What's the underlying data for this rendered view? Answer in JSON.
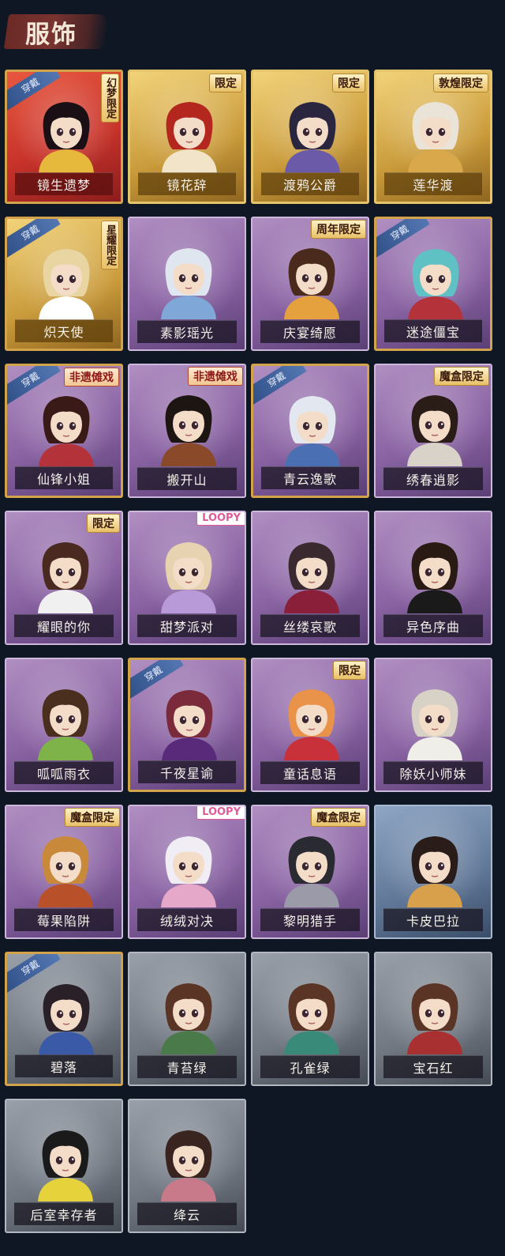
{
  "header": {
    "title": "服饰"
  },
  "badges": {
    "equipped": "穿戴"
  },
  "costumes": [
    {
      "name": "镜生遗梦",
      "frame": "red",
      "equipped": true,
      "tag": "幻梦限定",
      "vertical": true,
      "hair": "#1a0f14",
      "accent": "#e6b83b"
    },
    {
      "name": "镜花辞",
      "frame": "gold",
      "equipped": false,
      "tag": "限定",
      "hair": "#b4271f",
      "accent": "#f1e4c8"
    },
    {
      "name": "渡鸦公爵",
      "frame": "gold",
      "equipped": false,
      "tag": "限定",
      "hair": "#2a2640",
      "accent": "#6b5aa8"
    },
    {
      "name": "莲华渡",
      "frame": "gold",
      "equipped": false,
      "tag": "敦煌限定",
      "hair": "#e9e3d8",
      "accent": "#d8a84a"
    },
    {
      "name": "炽天使",
      "frame": "gold",
      "equipped": true,
      "tag": "星耀限定",
      "vertical": true,
      "hair": "#e8d5a2",
      "accent": "#ffffff"
    },
    {
      "name": "素影瑶光",
      "frame": "purple",
      "equipped": false,
      "tag": "",
      "hair": "#dfe6ef",
      "accent": "#7fa7d8"
    },
    {
      "name": "庆宴绮愿",
      "frame": "purple",
      "equipped": false,
      "tag": "周年限定",
      "hair": "#4a2a1c",
      "accent": "#e6a13f"
    },
    {
      "name": "迷途僵宝",
      "frame": "purple",
      "equipped": true,
      "tag": "",
      "hair": "#5fc1c4",
      "accent": "#b4333a"
    },
    {
      "name": "仙锋小姐",
      "frame": "purple",
      "equipped": true,
      "tag": "非遗傩戏",
      "redInk": true,
      "hair": "#3a1a16",
      "accent": "#b4333a"
    },
    {
      "name": "搬开山",
      "frame": "purple",
      "equipped": false,
      "tag": "非遗傩戏",
      "redInk": true,
      "hair": "#1c1512",
      "accent": "#8a4a2a"
    },
    {
      "name": "青云逸歌",
      "frame": "purple",
      "equipped": true,
      "tag": "",
      "hair": "#e3e8f0",
      "accent": "#4a6fb3"
    },
    {
      "name": "绣春逍影",
      "frame": "purple",
      "equipped": false,
      "tag": "魔盒限定",
      "hair": "#2a1c16",
      "accent": "#d8d2c8"
    },
    {
      "name": "耀眼的你",
      "frame": "purple",
      "equipped": false,
      "tag": "限定",
      "hair": "#4a2a20",
      "accent": "#f0f0f0"
    },
    {
      "name": "甜梦派对",
      "frame": "purple",
      "equipped": false,
      "tag": "LOOPY",
      "loopy": true,
      "hair": "#e8d3b0",
      "accent": "#b89ad8"
    },
    {
      "name": "丝缕哀歌",
      "frame": "purple",
      "equipped": false,
      "tag": "",
      "hair": "#3a2a30",
      "accent": "#8a1f3a"
    },
    {
      "name": "异色序曲",
      "frame": "purple",
      "equipped": false,
      "tag": "",
      "hair": "#2a1a14",
      "accent": "#1a1a1a"
    },
    {
      "name": "呱呱雨衣",
      "frame": "purple",
      "equipped": false,
      "tag": "",
      "hair": "#4a2e1e",
      "accent": "#7eb34a"
    },
    {
      "name": "千夜星谕",
      "frame": "purple",
      "equipped": true,
      "tag": "",
      "hair": "#7a2a3a",
      "accent": "#5a2a7a"
    },
    {
      "name": "童话息语",
      "frame": "purple",
      "equipped": false,
      "tag": "限定",
      "hair": "#e8924a",
      "accent": "#c8303a"
    },
    {
      "name": "除妖小师妹",
      "frame": "purple",
      "equipped": false,
      "tag": "",
      "hair": "#d8d2c6",
      "accent": "#f0eee8"
    },
    {
      "name": "莓果陷阱",
      "frame": "purple",
      "equipped": false,
      "tag": "魔盒限定",
      "hair": "#c8893a",
      "accent": "#b8502a"
    },
    {
      "name": "绒绒对决",
      "frame": "purple",
      "equipped": false,
      "tag": "LOOPY",
      "loopy": true,
      "hair": "#f0eef4",
      "accent": "#e6a8c8"
    },
    {
      "name": "黎明猎手",
      "frame": "purple",
      "equipped": false,
      "tag": "魔盒限定",
      "hair": "#2a2a32",
      "accent": "#9a9aa8"
    },
    {
      "name": "卡皮巴拉",
      "frame": "blue",
      "equipped": false,
      "tag": "",
      "hair": "#2a1c18",
      "accent": "#d8a04a"
    },
    {
      "name": "碧落",
      "frame": "grey",
      "equipped": true,
      "tag": "",
      "hair": "#2a2028",
      "accent": "#3a5aa8"
    },
    {
      "name": "青苔绿",
      "frame": "grey",
      "equipped": false,
      "tag": "",
      "hair": "#5a3424",
      "accent": "#4a7a4a"
    },
    {
      "name": "孔雀绿",
      "frame": "grey",
      "equipped": false,
      "tag": "",
      "hair": "#5a3424",
      "accent": "#3a8a7a"
    },
    {
      "name": "宝石红",
      "frame": "grey",
      "equipped": false,
      "tag": "",
      "hair": "#5a3424",
      "accent": "#a83030"
    },
    {
      "name": "后室幸存者",
      "frame": "grey",
      "equipped": false,
      "tag": "",
      "hair": "#1a1a1a",
      "accent": "#e6d23a"
    },
    {
      "name": "绛云",
      "frame": "grey",
      "equipped": false,
      "tag": "",
      "hair": "#3a2420",
      "accent": "#c87a8a"
    }
  ]
}
